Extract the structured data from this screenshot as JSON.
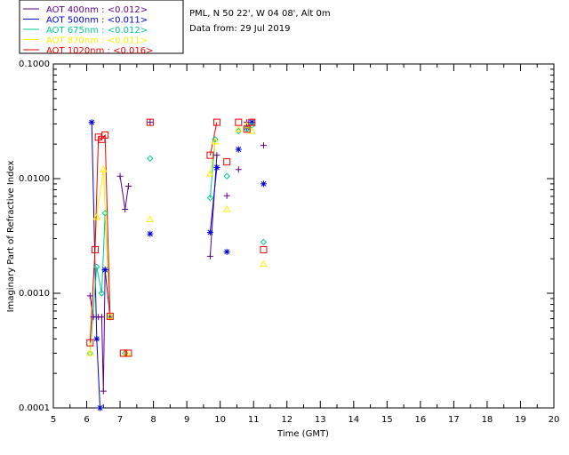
{
  "header": {
    "location": "PML, N 50 22', W 04 08', Alt 0m",
    "date": "Data from: 29 Jul 2019"
  },
  "chart_data": {
    "type": "scatter",
    "xlabel": "Time (GMT)",
    "ylabel": "Imaginary Part of Refractive Index",
    "xlim": [
      5,
      20
    ],
    "ylim": [
      0.0001,
      0.1
    ],
    "y_scale": "log",
    "grid": false,
    "legend_position": "top-left",
    "x_ticks": [
      "5",
      "6",
      "7",
      "8",
      "9",
      "10",
      "11",
      "12",
      "13",
      "14",
      "15",
      "16",
      "17",
      "18",
      "19",
      "20"
    ],
    "y_ticks": [
      {
        "value": 0.0001,
        "label": "0.0001"
      },
      {
        "value": 0.001,
        "label": "0.0010"
      },
      {
        "value": 0.01,
        "label": "0.0100"
      },
      {
        "value": 0.1,
        "label": "0.1000"
      }
    ],
    "series": [
      {
        "name": "AOT  400nm : <0.012>",
        "color": "#5a008c",
        "marker": "plus",
        "points": [
          [
            6.1,
            0.00095
          ],
          [
            6.2,
            0.00062
          ],
          [
            6.35,
            0.00062
          ],
          [
            6.45,
            0.00062
          ],
          [
            6.5,
            0.00014
          ],
          [
            6.55,
            0.0016
          ],
          [
            6.7,
            0.00062
          ],
          [
            7.0,
            0.0105
          ],
          [
            7.15,
            0.0054
          ],
          [
            7.25,
            0.0086
          ],
          [
            7.9,
            0.031
          ],
          [
            9.7,
            0.0021
          ],
          [
            9.9,
            0.016
          ],
          [
            10.2,
            0.0071
          ],
          [
            10.55,
            0.012
          ],
          [
            10.8,
            0.031
          ],
          [
            10.95,
            0.031
          ],
          [
            11.3,
            0.0195
          ]
        ],
        "lines": [
          [
            [
              6.1,
              0.00095
            ],
            [
              6.2,
              0.00062
            ],
            [
              6.35,
              0.00062
            ],
            [
              6.45,
              0.00062
            ],
            [
              6.5,
              0.00014
            ],
            [
              6.55,
              0.0016
            ],
            [
              6.7,
              0.00062
            ]
          ],
          [
            [
              7.0,
              0.0105
            ],
            [
              7.15,
              0.0054
            ],
            [
              7.25,
              0.0086
            ]
          ],
          [
            [
              9.7,
              0.0021
            ],
            [
              9.9,
              0.016
            ]
          ]
        ]
      },
      {
        "name": "AOT  500nm : <0.011>",
        "color": "#0000dd",
        "marker": "asterisk",
        "points": [
          [
            6.15,
            0.031
          ],
          [
            6.3,
            0.0004
          ],
          [
            6.4,
            0.0001
          ],
          [
            6.55,
            0.0016
          ],
          [
            7.9,
            0.0033
          ],
          [
            9.7,
            0.0034
          ],
          [
            9.9,
            0.0125
          ],
          [
            10.2,
            0.0023
          ],
          [
            10.55,
            0.018
          ],
          [
            10.8,
            0.028
          ],
          [
            10.95,
            0.031
          ],
          [
            11.3,
            0.009
          ]
        ],
        "lines": [
          [
            [
              6.15,
              0.031
            ],
            [
              6.3,
              0.0004
            ],
            [
              6.4,
              0.0001
            ]
          ],
          [
            [
              9.7,
              0.0034
            ],
            [
              9.9,
              0.0125
            ]
          ]
        ]
      },
      {
        "name": "AOT  675nm : <0.012>",
        "color": "#00cc88",
        "marker": "diamond",
        "points": [
          [
            6.1,
            0.0003
          ],
          [
            6.3,
            0.0017
          ],
          [
            6.45,
            0.001
          ],
          [
            6.55,
            0.005
          ],
          [
            6.7,
            0.00063
          ],
          [
            7.15,
            0.0003
          ],
          [
            7.9,
            0.015
          ],
          [
            9.7,
            0.0068
          ],
          [
            9.85,
            0.022
          ],
          [
            10.2,
            0.0105
          ],
          [
            10.55,
            0.026
          ],
          [
            10.8,
            0.027
          ],
          [
            10.95,
            0.029
          ],
          [
            11.3,
            0.0028
          ]
        ],
        "lines": [
          [
            [
              6.1,
              0.0003
            ],
            [
              6.3,
              0.0017
            ],
            [
              6.45,
              0.001
            ],
            [
              6.55,
              0.005
            ],
            [
              6.7,
              0.00063
            ]
          ],
          [
            [
              9.7,
              0.0068
            ],
            [
              9.85,
              0.022
            ]
          ]
        ]
      },
      {
        "name": "AOT  870nm : <0.011>",
        "color": "#ffee00",
        "marker": "triangle",
        "points": [
          [
            6.1,
            0.0003
          ],
          [
            6.3,
            0.0046
          ],
          [
            6.5,
            0.012
          ],
          [
            6.7,
            0.00063
          ],
          [
            7.2,
            0.0003
          ],
          [
            7.9,
            0.0044
          ],
          [
            9.7,
            0.011
          ],
          [
            9.85,
            0.021
          ],
          [
            10.2,
            0.0054
          ],
          [
            10.55,
            0.027
          ],
          [
            10.8,
            0.029
          ],
          [
            10.95,
            0.026
          ],
          [
            11.3,
            0.0018
          ]
        ],
        "lines": [
          [
            [
              6.1,
              0.0003
            ],
            [
              6.3,
              0.0046
            ],
            [
              6.5,
              0.012
            ],
            [
              6.7,
              0.00063
            ]
          ],
          [
            [
              9.7,
              0.011
            ],
            [
              9.85,
              0.021
            ]
          ]
        ]
      },
      {
        "name": "AOT 1020nm : <0.016>",
        "color": "#ee0000",
        "marker": "square",
        "points": [
          [
            6.1,
            0.00037
          ],
          [
            6.25,
            0.0024
          ],
          [
            6.35,
            0.023
          ],
          [
            6.45,
            0.022
          ],
          [
            6.55,
            0.024
          ],
          [
            6.7,
            0.00063
          ],
          [
            7.1,
            0.0003
          ],
          [
            7.25,
            0.0003
          ],
          [
            7.9,
            0.031
          ],
          [
            9.7,
            0.016
          ],
          [
            9.9,
            0.031
          ],
          [
            10.2,
            0.014
          ],
          [
            10.55,
            0.031
          ],
          [
            10.8,
            0.027
          ],
          [
            10.95,
            0.031
          ],
          [
            11.3,
            0.0024
          ]
        ],
        "lines": [
          [
            [
              6.1,
              0.00037
            ],
            [
              6.25,
              0.0024
            ],
            [
              6.35,
              0.023
            ],
            [
              6.45,
              0.022
            ],
            [
              6.55,
              0.024
            ],
            [
              6.7,
              0.00063
            ]
          ],
          [
            [
              9.7,
              0.016
            ],
            [
              9.9,
              0.031
            ]
          ]
        ]
      }
    ]
  }
}
